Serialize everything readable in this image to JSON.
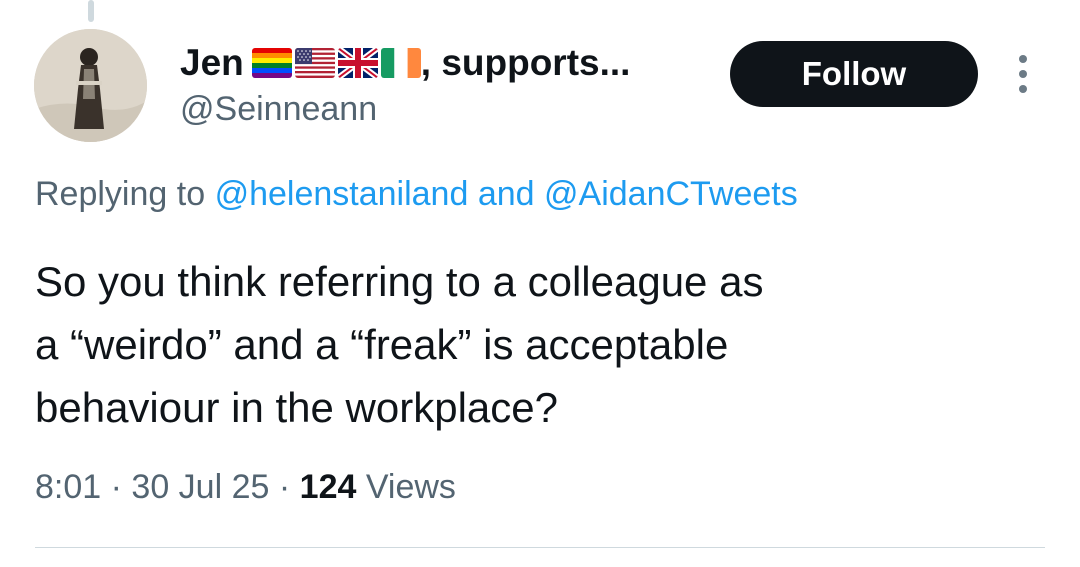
{
  "author": {
    "display_name": "Jen",
    "name_suffix": ", supports...",
    "handle": "@Seinneann",
    "flags": [
      "rainbow-pride-flag",
      "us-flag",
      "uk-flag",
      "ireland-flag"
    ]
  },
  "follow_label": "Follow",
  "reply": {
    "prefix": "Replying to",
    "mention1": "@helenstaniland",
    "conjunction": "and",
    "mention2": "@AidanCTweets"
  },
  "tweet": {
    "lines": [
      "So you think referring to a colleague as",
      "a “weirdo” and a “freak” is acceptable",
      "behaviour in the workplace?"
    ]
  },
  "meta": {
    "time": "8:01",
    "separator": "·",
    "date": "30 Jul 25",
    "views_count": "124",
    "views_label": "Views"
  },
  "colors": {
    "text": "#0f1419",
    "secondary": "#536471",
    "link": "#1d9bf0",
    "button_bg": "#0f1419"
  }
}
